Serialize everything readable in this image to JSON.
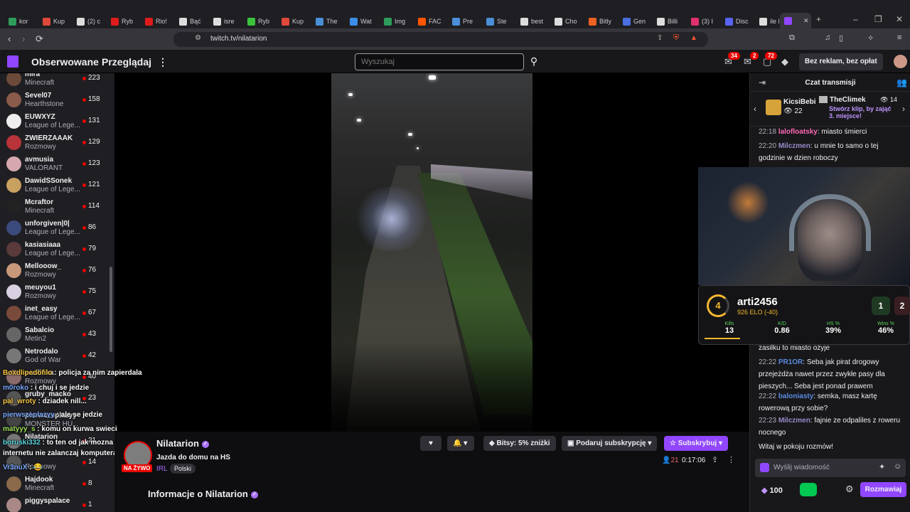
{
  "browser": {
    "tabs": [
      {
        "label": "kor",
        "color": "#2e9c5b"
      },
      {
        "label": "Kup",
        "color": "#e0483a"
      },
      {
        "label": "(2) c",
        "color": "#dddddd"
      },
      {
        "label": "Ryb",
        "color": "#e01b1b"
      },
      {
        "label": "Rio!",
        "color": "#e01b1b"
      },
      {
        "label": "Bąć",
        "color": "#dddddd"
      },
      {
        "label": "isre",
        "color": "#dddddd"
      },
      {
        "label": "Ryb",
        "color": "#3ac23a"
      },
      {
        "label": "Kup",
        "color": "#e0483a"
      },
      {
        "label": "The",
        "color": "#4a8fd8"
      },
      {
        "label": "Wat",
        "color": "#3a8ee6"
      },
      {
        "label": "Img",
        "color": "#2e9c5b"
      },
      {
        "label": "FAC",
        "color": "#ff5500"
      },
      {
        "label": "Pre",
        "color": "#4a8fd8"
      },
      {
        "label": "Ste",
        "color": "#4a8fd8"
      },
      {
        "label": "best",
        "color": "#dddddd"
      },
      {
        "label": "Cho",
        "color": "#dddddd"
      },
      {
        "label": "Bitly",
        "color": "#ee6123"
      },
      {
        "label": "Gen",
        "color": "#4a6ee0"
      },
      {
        "label": "Billi",
        "color": "#dddddd"
      },
      {
        "label": "(3) I",
        "color": "#e1306c"
      },
      {
        "label": "Disc",
        "color": "#5865f2"
      },
      {
        "label": "ile l",
        "color": "#dddddd"
      }
    ],
    "url": "twitch.tv/nilatarion"
  },
  "header": {
    "following": "Obserwowane",
    "browse": "Przeglądaj",
    "search_placeholder": "Wyszukaj",
    "badges": {
      "inbox": "34",
      "whispers": "2",
      "notifications": "72"
    },
    "no_ads": "Bez reklam, bez opłat"
  },
  "sidebar": {
    "channels": [
      {
        "name": "mira",
        "game": "Minecraft",
        "viewers": "223",
        "color": "#6b4a3a"
      },
      {
        "name": "Sevel07",
        "game": "Hearthstone",
        "viewers": "158",
        "color": "#8a5a4a"
      },
      {
        "name": "EUWXYZ",
        "game": "League of Lege...",
        "viewers": "131",
        "color": "#eeeeee"
      },
      {
        "name": "ZWIERZAAAK",
        "game": "Rozmowy",
        "viewers": "129",
        "color": "#b8343a"
      },
      {
        "name": "avmusia",
        "game": "VALORANT",
        "viewers": "123",
        "color": "#d7a7b0"
      },
      {
        "name": "DawidSSonek",
        "game": "League of Lege...",
        "viewers": "121",
        "color": "#c8a060"
      },
      {
        "name": "Mcraftor",
        "game": "Minecraft",
        "viewers": "114",
        "color": "#222222"
      },
      {
        "name": "unforgiven|0|",
        "game": "League of Lege...",
        "viewers": "86",
        "color": "#3a4a7a"
      },
      {
        "name": "kasiasiaaa",
        "game": "League of Lege...",
        "viewers": "79",
        "color": "#5a3a3a"
      },
      {
        "name": "Mellooow_",
        "game": "Rozmowy",
        "viewers": "76",
        "color": "#c8987a"
      },
      {
        "name": "meuyou1",
        "game": "Rozmowy",
        "viewers": "75",
        "color": "#d8d0e0"
      },
      {
        "name": "inet_easy",
        "game": "League of Lege...",
        "viewers": "67",
        "color": "#7a4a3a"
      },
      {
        "name": "Sabalcio",
        "game": "Metin2",
        "viewers": "43",
        "color": "#666666"
      },
      {
        "name": "Netrodalo",
        "game": "God of War",
        "viewers": "42",
        "color": "#777777"
      },
      {
        "name": "paulinka",
        "game": "Rozmowy",
        "viewers": "40",
        "color": "#8a6a6a"
      },
      {
        "name": "gruby_macko",
        "game": "",
        "viewers": "23",
        "color": "#555555"
      },
      {
        "name": "pierwszeplazyy",
        "game": "MONSTER HU...",
        "viewers": "",
        "color": "#444444"
      },
      {
        "name": "Nilatarion",
        "game": "",
        "viewers": "21",
        "color": "#777777"
      },
      {
        "name": "",
        "game": "Rozmowy",
        "viewers": "14",
        "color": "#555555"
      },
      {
        "name": "Hajdook",
        "game": "Minecraft",
        "viewers": "8",
        "color": "#8a6a4a"
      },
      {
        "name": "piggyspalace",
        "game": "",
        "viewers": "1",
        "color": "#aa8888"
      }
    ]
  },
  "overlay_chat": [
    {
      "user": "Boxdlipedofilo",
      "msg": ": policja za nim zapierdala",
      "color": "#f5c542"
    },
    {
      "user": "m0roko",
      "msg": ": i chuj i se jedzie",
      "color": "#7aa8ff"
    },
    {
      "user": "pal_wroty",
      "msg": ": dziadek nill...",
      "color": "#f5c542"
    },
    {
      "user": "pierwszeplazyy",
      "msg": ": ale se jedzie",
      "color": "#7aa8ff"
    },
    {
      "user": "matyyy_s",
      "msg": ": komu on kurwa swieci",
      "color": "#9fe05a"
    },
    {
      "user": "boruski332",
      "msg": ": to ten od jak mozna nie miec",
      "color": "#5ad8e0"
    },
    {
      "user": "",
      "msg": "internetu nie zalanczaj komputera nie?",
      "color": "#5ad8e0"
    },
    {
      "user": "Vr3nuX",
      "msg": ": 😂",
      "color": "#7aa8ff"
    }
  ],
  "stream": {
    "streamer": "Nilatarion",
    "live": "NA ŻYWO",
    "title": "Jazda do domu na HS",
    "category": "IRL",
    "tag": "Polski",
    "bits": "Bitsy: 5% zniżki",
    "gift": "Podaruj subskrypcję",
    "subscribe": "Subskrybuj",
    "viewers": "21",
    "uptime": "0:17:06",
    "about": "Informacje o Nilatarion"
  },
  "faceit": {
    "level": "4",
    "player": "arti2456",
    "elo": "926 ELO (-40)",
    "score_a": "1",
    "score_b": "2",
    "stats": [
      {
        "label": "Kills",
        "value": "13"
      },
      {
        "label": "K/D",
        "value": "0.86"
      },
      {
        "label": "HS %",
        "value": "39%"
      },
      {
        "label": "Wins %",
        "value": "46%"
      }
    ]
  },
  "chat": {
    "title": "Czat transmisji",
    "leader": {
      "first_name": "KicsiBebi",
      "first_count": "22",
      "second_name": "TheClimek",
      "second_count": "14",
      "cta": "Stwórz klip, by zająć 3. miejsce!"
    },
    "messages_top": [
      {
        "time": "22:18",
        "user": "lalofloatsky",
        "msg": ": miasto śmierci",
        "color": "#ff69b4"
      },
      {
        "time": "22:20",
        "user": "Milczmen",
        "msg": ": u mnie to samo o tej godzinie w dzien roboczy",
        "color": "#9a8ac8"
      }
    ],
    "messages_bottom": [
      {
        "time": "",
        "user": "",
        "msg": "zasilku to miasto ożyje",
        "color": "#efeff1"
      },
      {
        "time": "22:22",
        "user": "PR1OR",
        "msg": ": Seba jak pirat drogowy przejeżdża nawet przez zwykłe pasy dla pieszych... Seba jest ponad prawem",
        "color": "#5a8ae0"
      },
      {
        "time": "22:22",
        "user": "baloniasty",
        "msg": ": semka, masz kartę rowerową przy sobie?",
        "color": "#5a8ae0"
      },
      {
        "time": "22:23",
        "user": "Milczmen",
        "msg": ": fajnie ze odpaliles z roweru nocnego",
        "color": "#9a8ac8"
      }
    ],
    "welcome": "Witaj w pokoju rozmów!",
    "input_placeholder": "Wyślij wiadomość",
    "points": "100",
    "send": "Rozmawiaj"
  }
}
